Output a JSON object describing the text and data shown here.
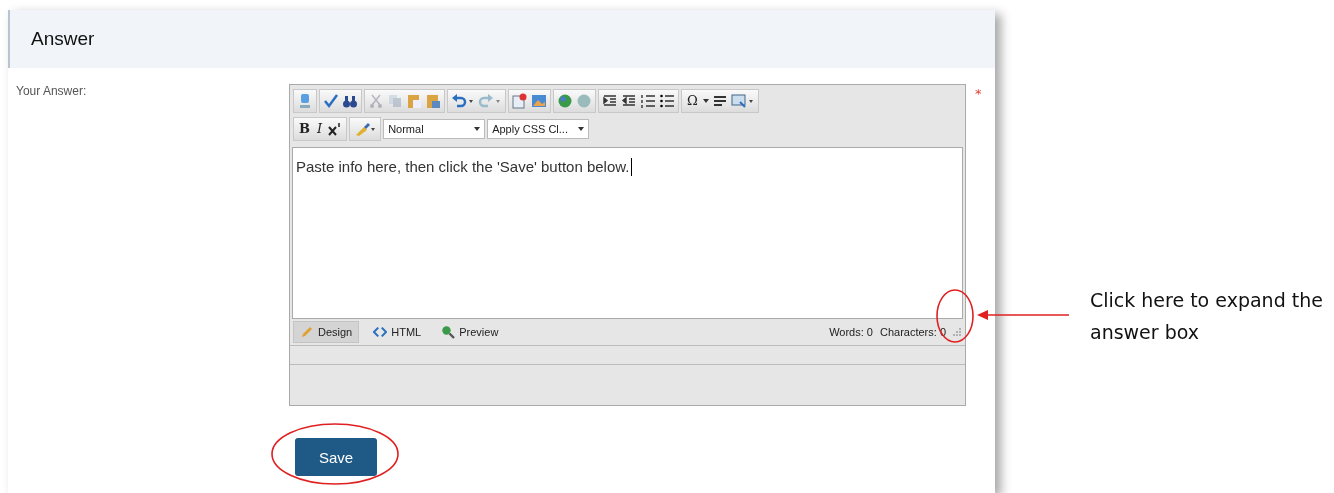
{
  "section": {
    "title": "Answer"
  },
  "field": {
    "label": "Your Answer:",
    "required_mark": "*"
  },
  "editor": {
    "symbol_button": "Ω",
    "bold": "B",
    "italic": "I",
    "format_dropdown": "Normal",
    "css_dropdown": "Apply CSS Cl...",
    "value": "Paste info here, then click the 'Save' button below.",
    "modes": [
      {
        "label": "Design",
        "selected": true
      },
      {
        "label": "HTML",
        "selected": false
      },
      {
        "label": "Preview",
        "selected": false
      }
    ],
    "words": "Words: 0",
    "characters": "Characters: 0"
  },
  "save_button": "Save",
  "annotation": "Click here to expand the answer box"
}
